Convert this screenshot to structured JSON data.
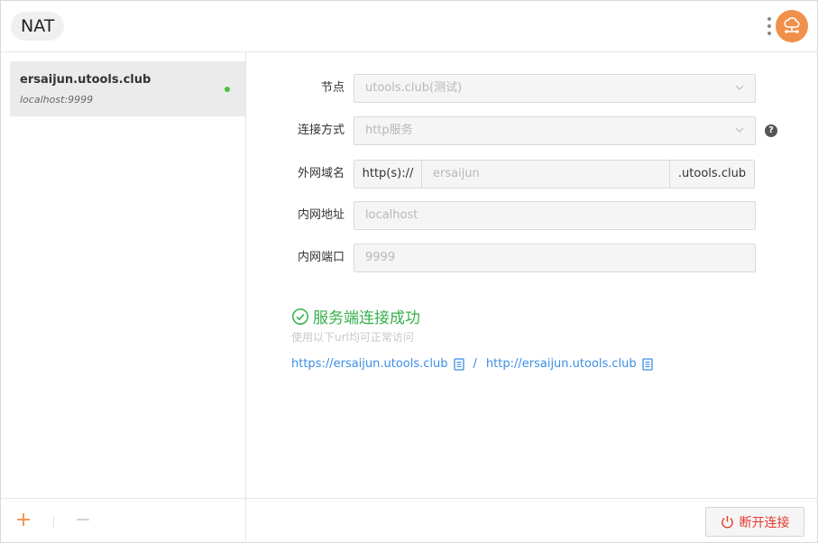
{
  "header": {
    "title": "NAT"
  },
  "sidebar": {
    "tunnels": [
      {
        "name": "ersaijun.utools.club",
        "address": "localhost:9999",
        "status_color": "#4cc13d"
      }
    ],
    "add_label": "+",
    "remove_label": "−"
  },
  "form": {
    "node": {
      "label": "节点",
      "value": "utools.club(测试)"
    },
    "connection": {
      "label": "连接方式",
      "value": "http服务",
      "help": "?"
    },
    "domain": {
      "label": "外网域名",
      "prefix": "http(s)://",
      "value": "ersaijun",
      "suffix": ".utools.club"
    },
    "local_host": {
      "label": "内网地址",
      "value": "localhost"
    },
    "local_port": {
      "label": "内网端口",
      "value": "9999"
    }
  },
  "status": {
    "title": "服务端连接成功",
    "hint": "使用以下url均可正常访问",
    "https_url": "https://ersaijun.utools.club",
    "separator": "/",
    "http_url": "http://ersaijun.utools.club",
    "color": "#35b04a"
  },
  "footer": {
    "disconnect_label": "断开连接",
    "disconnect_color": "#e5392f"
  },
  "colors": {
    "accent": "#f0904a",
    "link": "#3a8ee6"
  }
}
